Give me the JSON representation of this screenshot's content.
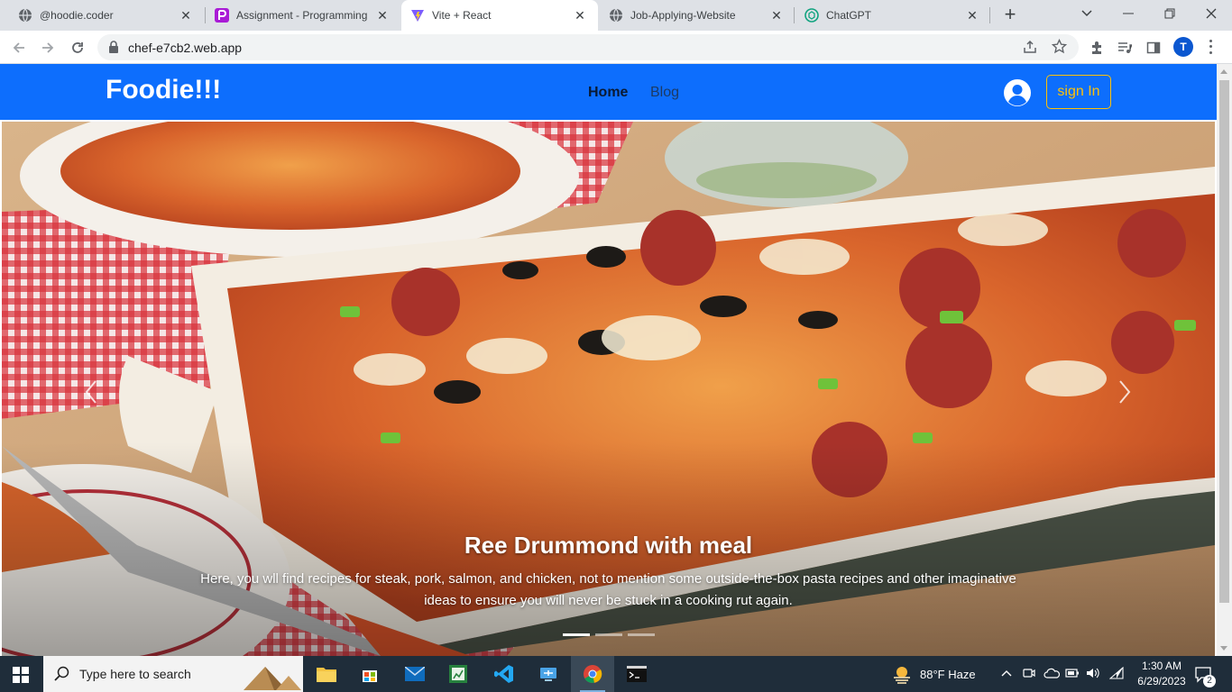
{
  "browser": {
    "tabs": [
      {
        "title": "@hoodie.coder",
        "icon": "globe-icon",
        "active": false
      },
      {
        "title": "Assignment - Programming Hero",
        "icon": "programming-hero-icon",
        "active": false
      },
      {
        "title": "Vite + React",
        "icon": "vite-icon",
        "active": true
      },
      {
        "title": "Job-Applying-Website",
        "icon": "globe-icon",
        "active": false
      },
      {
        "title": "ChatGPT",
        "icon": "chatgpt-icon",
        "active": false
      }
    ],
    "url": "chef-e7cb2.web.app",
    "profile_initial": "T"
  },
  "site": {
    "brand": "Foodie!!!",
    "nav": {
      "home": "Home",
      "blog": "Blog"
    },
    "sign_in": "sign In",
    "colors": {
      "navbar": "#0d6efd",
      "sign_in": "#ffc107"
    }
  },
  "carousel": {
    "caption_title": "Ree Drummond with meal",
    "caption_text": "Here, you wll find recipes for steak, pork, salmon, and chicken, not to mention some outside-the-box pasta recipes and other imaginative ideas to ensure you will never be stuck in a cooking rut again.",
    "slide_count": 3,
    "active_slide": 1
  },
  "taskbar": {
    "search_placeholder": "Type here to search",
    "weather": "88°F  Haze",
    "time": "1:30 AM",
    "date": "6/29/2023",
    "notification_count": "2"
  }
}
